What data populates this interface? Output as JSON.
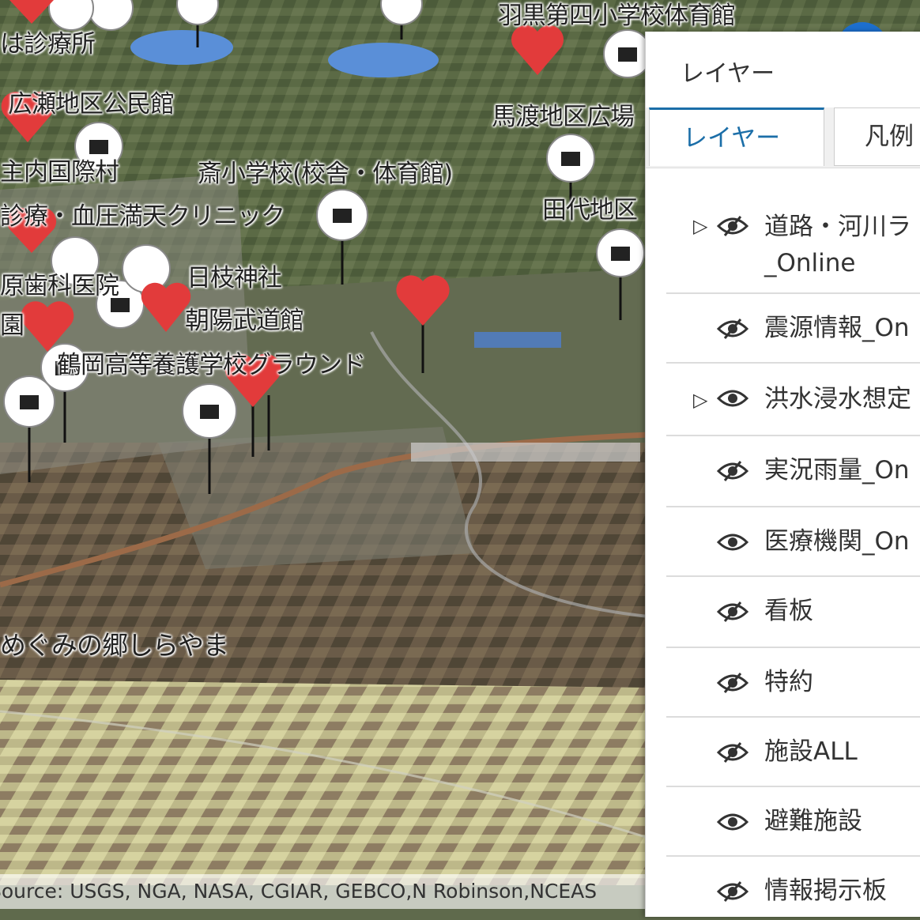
{
  "map": {
    "labels": [
      "羽黒第四小学校体育館",
      "馬渡地区広場",
      "は診療所",
      "広瀬地区公民館",
      "主内国際村",
      "斎小学校(校舎・体育館)",
      "田代地区",
      "診療・血圧満天クリニック",
      "日枝神社",
      "原歯科医院",
      "朝陽武道館",
      "園",
      "鶴岡高等養護学校グラウンド",
      "めぐみの郷しらやま"
    ],
    "attribution": "Source: USGS, NGA, NASA, CGIAR, GEBCO,N Robinson,NCEAS"
  },
  "panel": {
    "title": "レイヤー",
    "tabs": [
      "レイヤー",
      "凡例"
    ],
    "layers": [
      {
        "name": "道路・河川ラ",
        "name2": "_Online",
        "expandable": true,
        "visible": false
      },
      {
        "name": "震源情報_On",
        "expandable": false,
        "visible": false
      },
      {
        "name": "洪水浸水想定",
        "expandable": true,
        "visible": true
      },
      {
        "name": "実況雨量_On",
        "expandable": false,
        "visible": false
      },
      {
        "name": "医療機関_On",
        "expandable": false,
        "visible": true
      },
      {
        "name": "看板",
        "expandable": false,
        "visible": false
      },
      {
        "name": "特約",
        "expandable": false,
        "visible": false
      },
      {
        "name": "施設ALL",
        "expandable": false,
        "visible": false
      },
      {
        "name": "避難施設",
        "expandable": false,
        "visible": true
      },
      {
        "name": "情報掲示板",
        "expandable": false,
        "visible": false
      }
    ]
  },
  "colors": {
    "accent": "#1b6ea8",
    "heart": "#e23b3b",
    "panel_bg": "#ffffff"
  },
  "icons": [
    "heart-pin-icon",
    "building-pin-icon",
    "eye-icon",
    "eye-off-icon",
    "chevron-right-icon"
  ]
}
